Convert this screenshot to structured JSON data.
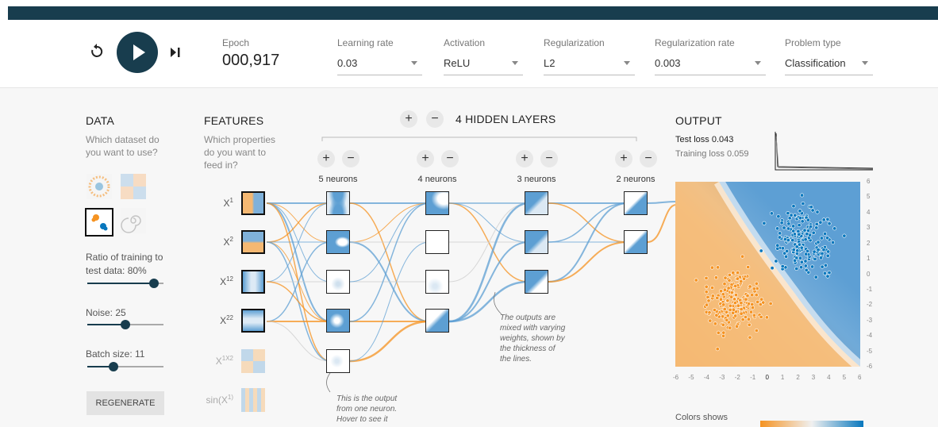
{
  "controls": {
    "epoch_label": "Epoch",
    "epoch_value": "000,917",
    "learning_rate": {
      "label": "Learning rate",
      "value": "0.03"
    },
    "activation": {
      "label": "Activation",
      "value": "ReLU"
    },
    "regularization": {
      "label": "Regularization",
      "value": "L2"
    },
    "regularization_rate": {
      "label": "Regularization rate",
      "value": "0.003"
    },
    "problem_type": {
      "label": "Problem type",
      "value": "Classification"
    }
  },
  "data_panel": {
    "title": "DATA",
    "subtitle_1": "Which dataset do",
    "subtitle_2": "you want to use?",
    "ratio_label_1": "Ratio of training to",
    "ratio_label_2": "test data:  80%",
    "ratio_value": 0.8,
    "noise_label": "Noise:  25",
    "noise_value": 25,
    "batch_label": "Batch size:  11",
    "batch_value": 11,
    "regenerate": "REGENERATE"
  },
  "features_panel": {
    "title": "FEATURES",
    "sub_1": "Which properties",
    "sub_2": "do you want to",
    "sub_3": "feed in?",
    "items": [
      {
        "base": "X",
        "sup": "1"
      },
      {
        "base": "X",
        "sup": "2"
      },
      {
        "base": "X",
        "sup": "12"
      },
      {
        "base": "X",
        "sup": "22"
      },
      {
        "base": "X",
        "sup": "1X2"
      },
      {
        "base": "sin(X",
        "sup": "1)"
      }
    ]
  },
  "network": {
    "hidden_layers_label": "4  HIDDEN LAYERS",
    "plus": "+",
    "minus": "−",
    "layers": [
      {
        "neurons": "5 neurons"
      },
      {
        "neurons": "4 neurons"
      },
      {
        "neurons": "3 neurons"
      },
      {
        "neurons": "2 neurons"
      }
    ],
    "note_weights": [
      "The outputs are",
      "mixed with varying",
      "weights, shown by",
      "the thickness of",
      "the lines."
    ],
    "note_neuron": [
      "This is the output",
      "from one neuron.",
      "Hover to see it"
    ]
  },
  "output_panel": {
    "title": "OUTPUT",
    "test_loss": "Test loss 0.043",
    "training_loss": "Training loss 0.059",
    "colors_shows": "Colors shows",
    "x_ticks": [
      "-6",
      "-5",
      "-4",
      "-3",
      "-2",
      "-1",
      "0",
      "1",
      "2",
      "3",
      "4",
      "5",
      "6"
    ],
    "y_ticks": [
      "6",
      "5",
      "4",
      "3",
      "2",
      "1",
      "0",
      "-1",
      "-2",
      "-3",
      "-4",
      "-5",
      "-6"
    ]
  },
  "colors": {
    "blue": "#0877bd",
    "orange": "#f59322",
    "dark": "#183d4e"
  }
}
